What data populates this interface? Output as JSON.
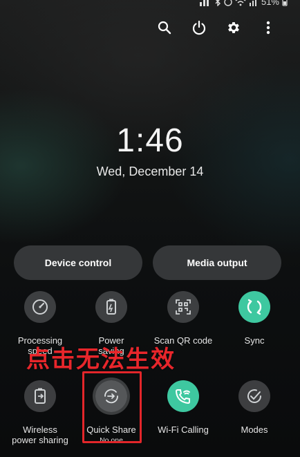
{
  "status_bar": {
    "battery": "51%"
  },
  "top_actions": [
    {
      "icon": "search-icon"
    },
    {
      "icon": "power-icon"
    },
    {
      "icon": "gear-icon"
    },
    {
      "icon": "more-vertical-icon"
    }
  ],
  "clock": {
    "time": "1:46",
    "date": "Wed, December 14"
  },
  "buttons": {
    "device_control": "Device control",
    "media_output": "Media output"
  },
  "tiles": {
    "processing_speed": {
      "label": "Processing speed",
      "icon": "speedometer-icon",
      "active": false
    },
    "power_saving": {
      "label": "Power saving",
      "icon": "battery-icon",
      "active": false
    },
    "scan_qr": {
      "label": "Scan QR code",
      "icon": "qr-code-icon",
      "active": false
    },
    "sync": {
      "label": "Sync",
      "icon": "sync-icon",
      "active": true
    },
    "wireless_power_sharing": {
      "label_line1": "Wireless",
      "label_line2": "power sharing",
      "icon": "battery-share-icon",
      "active": false
    },
    "quick_share": {
      "label": "Quick Share",
      "sub": "No one",
      "icon": "quick-share-icon",
      "active": false
    },
    "wifi_calling": {
      "label": "Wi-Fi Calling",
      "icon": "wifi-call-icon",
      "active": true
    },
    "modes": {
      "label": "Modes",
      "icon": "modes-check-icon",
      "active": false
    }
  },
  "annotation": {
    "text": "点击无法生效",
    "color": "#e8262b"
  },
  "colors": {
    "active_tile": "#3ec8a0",
    "annotation_box": "#e3262a"
  }
}
